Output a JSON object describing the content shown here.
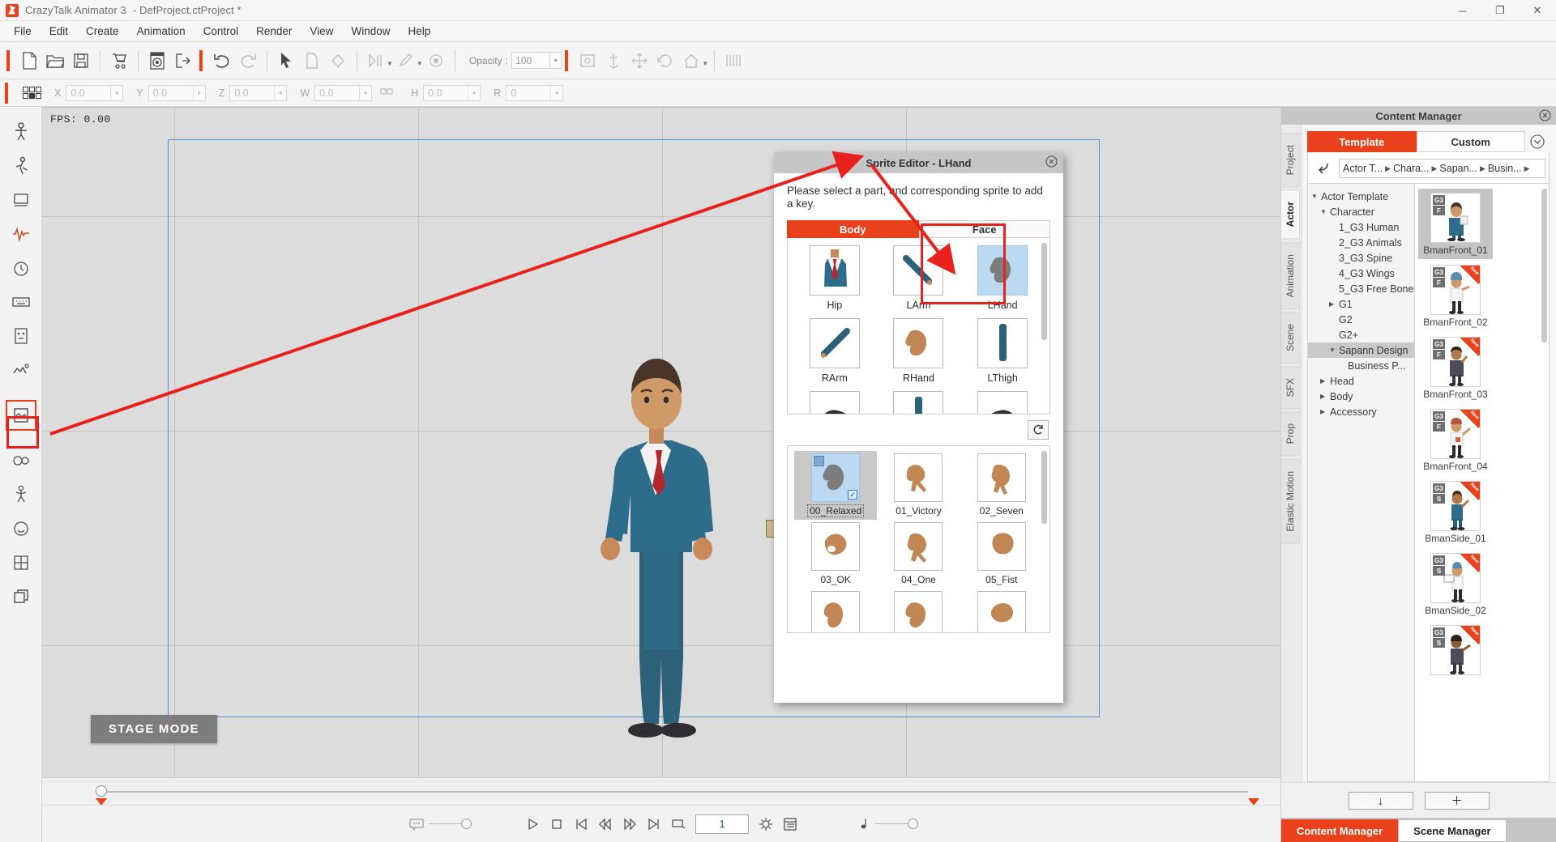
{
  "window": {
    "app_title": "CrazyTalk Animator 3",
    "document_title": "- DefProject.ctProject *",
    "minimize": "─",
    "maximize": "❐",
    "close": "✕"
  },
  "menubar": {
    "items": [
      "File",
      "Edit",
      "Create",
      "Animation",
      "Control",
      "Render",
      "View",
      "Window",
      "Help"
    ]
  },
  "toolbar": {
    "opacity_label": "Opacity :",
    "opacity_value": "100"
  },
  "transform_bar": {
    "fields": [
      {
        "label": "X",
        "value": "0.0"
      },
      {
        "label": "Y",
        "value": "0.0"
      },
      {
        "label": "Z",
        "value": "0.0"
      },
      {
        "label": "W",
        "value": "0.0"
      },
      {
        "label": "H",
        "value": "0.0"
      },
      {
        "label": "R",
        "value": "0"
      }
    ]
  },
  "stage": {
    "fps_label": "FPS: 0.00",
    "mode_badge": "STAGE MODE"
  },
  "transport": {
    "frame_value": "1"
  },
  "sprite_editor": {
    "title": "Sprite Editor - LHand",
    "hint": "Please select a part, and corresponding sprite to add a key.",
    "tabs": [
      {
        "label": "Body",
        "active": true
      },
      {
        "label": "Face",
        "active": false
      }
    ],
    "parts": [
      {
        "name": "Hip",
        "selected": false,
        "kind": "hip"
      },
      {
        "name": "LArm",
        "selected": false,
        "kind": "larm"
      },
      {
        "name": "LHand",
        "selected": true,
        "kind": "lhand"
      },
      {
        "name": "RArm",
        "selected": false,
        "kind": "rarm"
      },
      {
        "name": "RHand",
        "selected": false,
        "kind": "rhand"
      },
      {
        "name": "LThigh",
        "selected": false,
        "kind": "lthigh"
      },
      {
        "name": "",
        "selected": false,
        "kind": "shoe"
      },
      {
        "name": "",
        "selected": false,
        "kind": "rthigh"
      },
      {
        "name": "",
        "selected": false,
        "kind": "shoe2"
      }
    ],
    "refresh_icon": "refresh-icon",
    "sprites": [
      {
        "name": "00_Relaxed",
        "selected": true
      },
      {
        "name": "01_Victory",
        "selected": false
      },
      {
        "name": "02_Seven",
        "selected": false
      },
      {
        "name": "03_OK",
        "selected": false
      },
      {
        "name": "04_One",
        "selected": false
      },
      {
        "name": "05_Fist",
        "selected": false
      },
      {
        "name": "",
        "selected": false
      },
      {
        "name": "",
        "selected": false
      },
      {
        "name": "",
        "selected": false
      }
    ]
  },
  "content_manager": {
    "panel_title": "Content Manager",
    "vtabs": [
      "Project",
      "Actor",
      "Animation",
      "Scene",
      "SFX",
      "Prop",
      "Elastic Motion"
    ],
    "active_vtab": "Actor",
    "tabs": [
      {
        "label": "Template",
        "active": true
      },
      {
        "label": "Custom",
        "active": false
      }
    ],
    "breadcrumbs": [
      "Actor T...",
      "Chara...",
      "Sapan...",
      "Busin..."
    ],
    "tree": [
      {
        "label": "Actor Template",
        "indent": 0,
        "twisty": "▼",
        "selected": false
      },
      {
        "label": "Character",
        "indent": 1,
        "twisty": "▼",
        "selected": false
      },
      {
        "label": "1_G3 Human",
        "indent": 2,
        "twisty": "",
        "selected": false
      },
      {
        "label": "2_G3 Animals",
        "indent": 2,
        "twisty": "",
        "selected": false
      },
      {
        "label": "3_G3 Spine",
        "indent": 2,
        "twisty": "",
        "selected": false
      },
      {
        "label": "4_G3 Wings",
        "indent": 2,
        "twisty": "",
        "selected": false
      },
      {
        "label": "5_G3 Free Bone",
        "indent": 2,
        "twisty": "",
        "selected": false
      },
      {
        "label": "G1",
        "indent": 2,
        "twisty": "▶",
        "selected": false
      },
      {
        "label": "G2",
        "indent": 2,
        "twisty": "",
        "selected": false
      },
      {
        "label": "G2+",
        "indent": 2,
        "twisty": "",
        "selected": false
      },
      {
        "label": "Sapann Design",
        "indent": 2,
        "twisty": "▼",
        "selected": true
      },
      {
        "label": "Business P...",
        "indent": 3,
        "twisty": "",
        "selected": false
      },
      {
        "label": "Head",
        "indent": 1,
        "twisty": "▶",
        "selected": false
      },
      {
        "label": "Body",
        "indent": 1,
        "twisty": "▶",
        "selected": false
      },
      {
        "label": "Accessory",
        "indent": 1,
        "twisty": "▶",
        "selected": false
      }
    ],
    "thumbnails": [
      {
        "label": "BmanFront_01",
        "badge1": "G3",
        "badge2": "F",
        "is_new": false,
        "selected": true
      },
      {
        "label": "BmanFront_02",
        "badge1": "G3",
        "badge2": "F",
        "is_new": true,
        "selected": false
      },
      {
        "label": "BmanFront_03",
        "badge1": "G3",
        "badge2": "F",
        "is_new": true,
        "selected": false
      },
      {
        "label": "BmanFront_04",
        "badge1": "G3",
        "badge2": "F",
        "is_new": true,
        "selected": false
      },
      {
        "label": "BmanSide_01",
        "badge1": "G3",
        "badge2": "S",
        "is_new": true,
        "selected": false
      },
      {
        "label": "BmanSide_02",
        "badge1": "G3",
        "badge2": "S",
        "is_new": true,
        "selected": false
      },
      {
        "label": "",
        "badge1": "G3",
        "badge2": "S",
        "is_new": true,
        "selected": false
      }
    ],
    "new_flag_text": "New",
    "footer_buttons": [
      {
        "icon": "download-arrow-icon",
        "glyph": "↓"
      },
      {
        "icon": "plus-icon",
        "glyph": "＋"
      }
    ],
    "bottom_tabs": [
      {
        "label": "Content Manager",
        "active": true
      },
      {
        "label": "Scene Manager",
        "active": false
      }
    ]
  },
  "colors": {
    "accent": "#e8411c",
    "highlight": "#e8211c",
    "selection_blue": "#bcd9f2",
    "stage_bg": "#dcdcdc"
  }
}
